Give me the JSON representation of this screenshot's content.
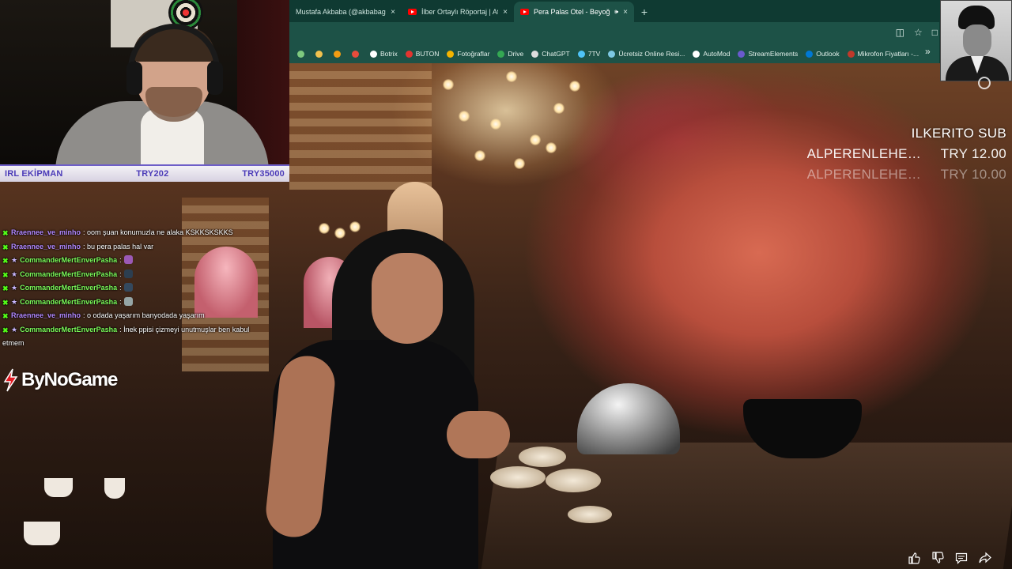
{
  "browser": {
    "tabs": [
      {
        "title": "Mustafa Akbaba (@akbabagraph)",
        "close": "×"
      },
      {
        "title": "İlber Ortaylı Röportaj | Atatürk",
        "close": "×"
      },
      {
        "title": "Pera Palas Otel - Beyoğlu'n",
        "close": "×"
      }
    ],
    "new_tab": "+",
    "bookmarks": [
      {
        "label": "",
        "color": "#7fc97f"
      },
      {
        "label": "",
        "color": "#f2c14e"
      },
      {
        "label": "",
        "color": "#f39c12"
      },
      {
        "label": "",
        "color": "#e74c3c"
      },
      {
        "label": "Botrix",
        "color": "#ffffff"
      },
      {
        "label": "BUTON",
        "color": "#e3342f"
      },
      {
        "label": "Fotoğraflar",
        "color": "#f4b400"
      },
      {
        "label": "Drive",
        "color": "#34a853"
      },
      {
        "label": "ChatGPT",
        "color": "#dddddd"
      },
      {
        "label": "7TV",
        "color": "#4fc3f7"
      },
      {
        "label": "Ücretsiz Online Resi...",
        "color": "#7ec8e3"
      },
      {
        "label": "AutoMod",
        "color": "#ffffff"
      },
      {
        "label": "StreamElements",
        "color": "#6a5acd"
      },
      {
        "label": "Outlook",
        "color": "#0078d4"
      },
      {
        "label": "Mikrofon Fiyatları -...",
        "color": "#c0392b"
      }
    ],
    "more": "»"
  },
  "donation_bar": {
    "label": "IRL EKİPMAN",
    "current": "TRY202",
    "goal": "TRY35000"
  },
  "chat": [
    {
      "user": "Rraennee_ve_minho",
      "text": ": oom şuan konumuzla ne alaka KSKKSKSKKS",
      "color": "#b288ff",
      "sub": false,
      "emote": null
    },
    {
      "user": "Rraennee_ve_minho",
      "text": ": bu pera palas hal var",
      "color": "#b288ff",
      "sub": false,
      "emote": null
    },
    {
      "user": "CommanderMertEnverPasha",
      "text": ":",
      "color": "#7cfc5a",
      "sub": true,
      "emote": "#9b59b6"
    },
    {
      "user": "CommanderMertEnverPasha",
      "text": ":",
      "color": "#7cfc5a",
      "sub": true,
      "emote": "#2c3e50"
    },
    {
      "user": "CommanderMertEnverPasha",
      "text": ":",
      "color": "#7cfc5a",
      "sub": true,
      "emote": "#34495e"
    },
    {
      "user": "CommanderMertEnverPasha",
      "text": ":",
      "color": "#7cfc5a",
      "sub": true,
      "emote": "#95a5a6"
    },
    {
      "user": "Rraennee_ve_minho",
      "text": ": o odada yaşarım banyodada yaşarım",
      "color": "#b288ff",
      "sub": false,
      "emote": null
    },
    {
      "user": "CommanderMertEnverPasha",
      "text": ": İnek ppisi çizmeyi unutmuşlar ben kabul etmem",
      "color": "#7cfc5a",
      "sub": true,
      "emote": null
    }
  ],
  "logo": {
    "text": "ByNoGame"
  },
  "alerts": {
    "title": "ILKERITO  SUB",
    "rows": [
      {
        "name": "ALPERENLEHERY...",
        "amount": "TRY 12.00"
      },
      {
        "name": "ALPERENLEHERY...",
        "amount": "TRY 10.00"
      }
    ]
  },
  "controls": [
    "thumbs-up-icon",
    "thumbs-down-icon",
    "comment-icon",
    "share-icon"
  ],
  "colors": {
    "donation_text": "#4b3bb8",
    "kick_green": "#53fc18",
    "browser_tab_bg": "#0f3a32",
    "browser_bar_bg": "#1d5247"
  }
}
